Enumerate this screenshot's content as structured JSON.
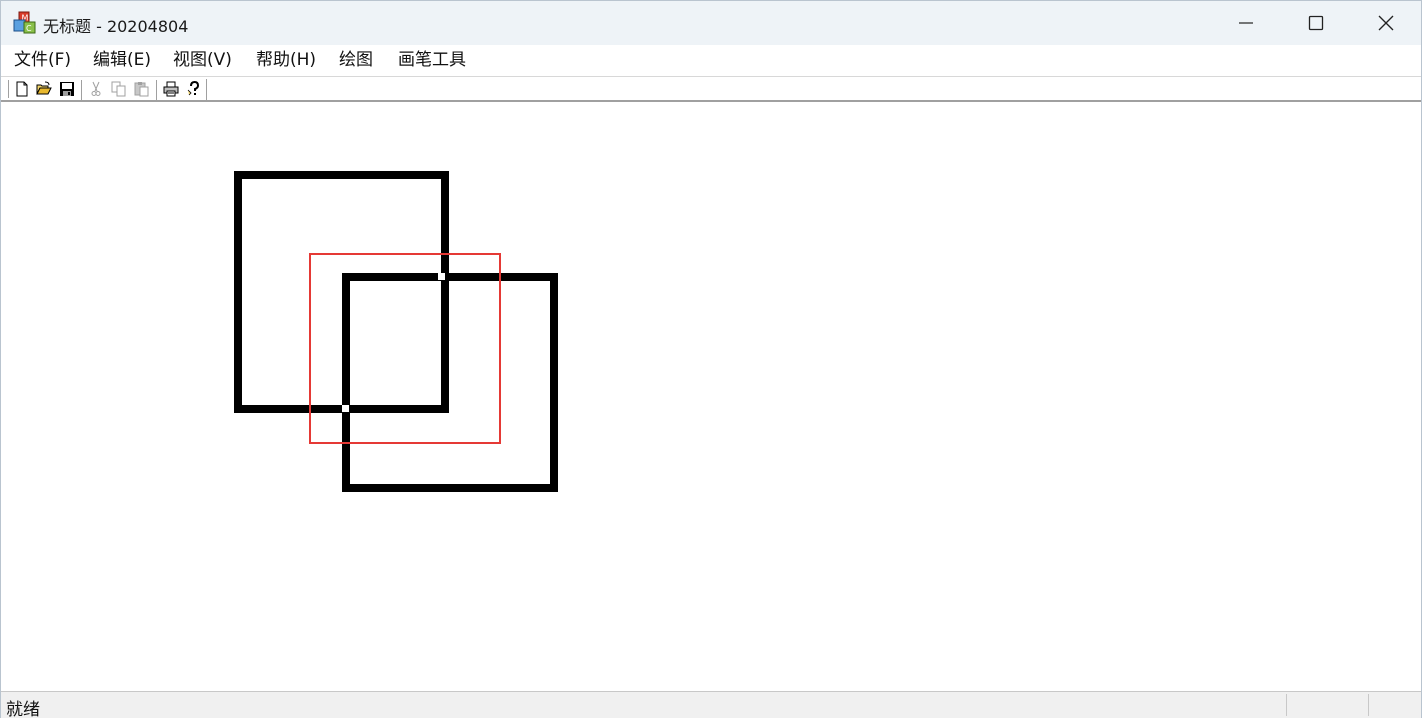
{
  "window": {
    "title": "无标题 - 20204804",
    "minimize_icon": "minimize-icon",
    "maximize_icon": "maximize-icon",
    "close_icon": "close-icon"
  },
  "menu": {
    "items": [
      {
        "label": "文件(F)"
      },
      {
        "label": "编辑(E)"
      },
      {
        "label": "视图(V)"
      },
      {
        "label": "帮助(H)"
      },
      {
        "label": "绘图"
      },
      {
        "label": "画笔工具"
      }
    ]
  },
  "toolbar": {
    "tools": [
      {
        "icon": "new-file-icon",
        "enabled": true
      },
      {
        "icon": "open-folder-icon",
        "enabled": true
      },
      {
        "icon": "save-icon",
        "enabled": true
      },
      {
        "icon": "cut-icon",
        "enabled": false
      },
      {
        "icon": "copy-icon",
        "enabled": false
      },
      {
        "icon": "paste-icon",
        "enabled": false
      },
      {
        "icon": "print-icon",
        "enabled": true
      },
      {
        "icon": "help-icon",
        "enabled": true
      }
    ]
  },
  "canvas": {
    "shapes": [
      {
        "type": "rectangle",
        "color": "#000000"
      },
      {
        "type": "rectangle",
        "color": "#000000"
      },
      {
        "type": "rectangle",
        "color": "#e53935"
      }
    ]
  },
  "status": {
    "text": "就绪"
  }
}
